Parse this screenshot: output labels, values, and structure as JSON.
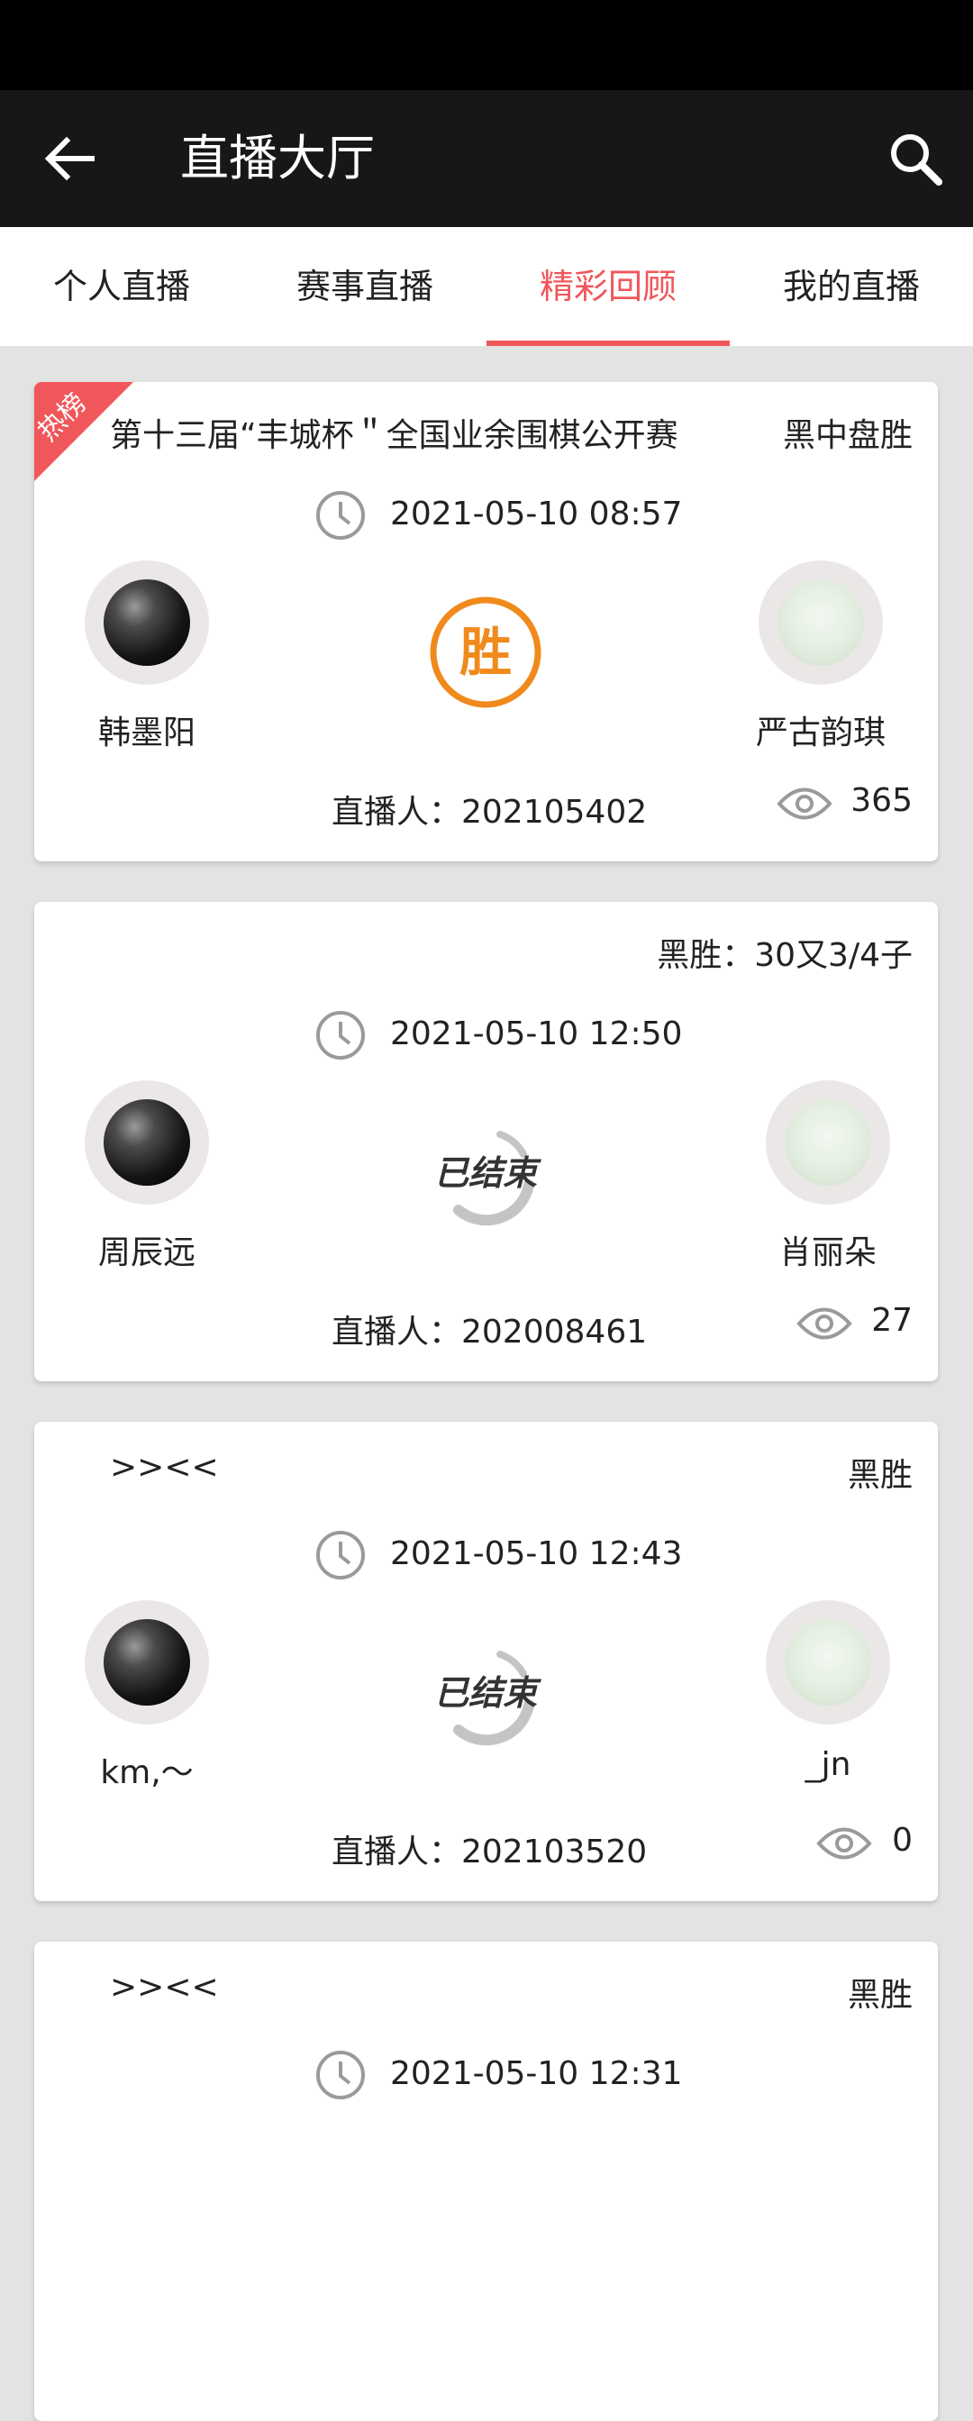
{
  "app_bar": {
    "title": "直播大厅"
  },
  "tabs": [
    {
      "label": "个人直播"
    },
    {
      "label": "赛事直播"
    },
    {
      "label": "精彩回顾"
    },
    {
      "label": "我的直播"
    }
  ],
  "active_tab": 2,
  "accent_color": "#f0575a",
  "ribbon_label": "热榜",
  "badges": {
    "win": "胜",
    "ended": "已结束"
  },
  "broadcaster_prefix": "直播人：",
  "cards": [
    {
      "title": "第十三届“丰城杯＂全国业余围棋公开赛",
      "result": "黑中盘胜",
      "time": "2021-05-10 08:57",
      "black": "韩墨阳",
      "white": "严古韵琪",
      "broadcaster": "直播人：202105402",
      "views": "365"
    },
    {
      "title": "",
      "result": "黑胜：30又3/4子",
      "time": "2021-05-10 12:50",
      "black": "周辰远",
      "white": "肖丽朵",
      "broadcaster": "直播人：202008461",
      "views": "27"
    },
    {
      "title": ">><<",
      "result": "黑胜",
      "time": "2021-05-10 12:43",
      "black": "km,～",
      "white": "_jn",
      "broadcaster": "直播人：202103520",
      "views": "0"
    },
    {
      "title": ">><<",
      "result": "黑胜",
      "time": "2021-05-10 12:31"
    }
  ]
}
